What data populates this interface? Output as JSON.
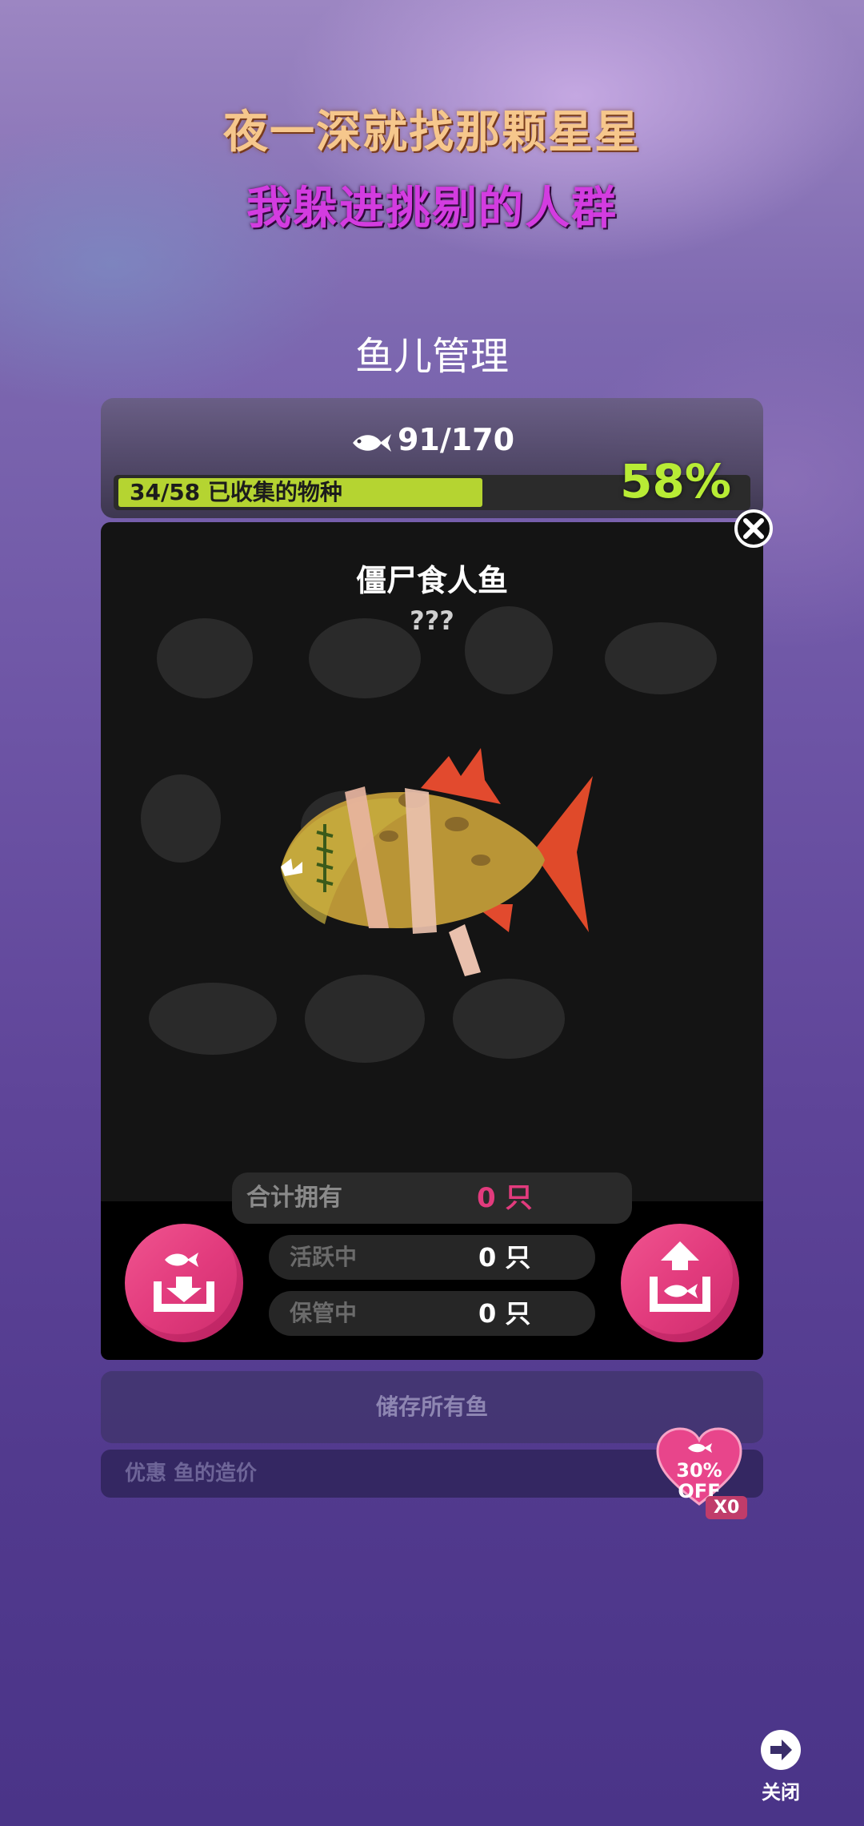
{
  "lyrics": {
    "line1": "夜一深就找那颗星星",
    "line2": "我躲进挑剔的人群"
  },
  "page": {
    "title": "鱼儿管理"
  },
  "stats": {
    "fish_count": "91/170",
    "progress_label": "34/58 已收集的物种",
    "percent": "58%",
    "progress_fraction": 0.58
  },
  "fish": {
    "name": "僵尸食人鱼",
    "info": "???"
  },
  "counts": {
    "total_label": "合计拥有",
    "total_value": "0 只",
    "active_label": "活跃中",
    "active_value": "0 只",
    "storage_label": "保管中",
    "storage_value": "0 只"
  },
  "actions": {
    "store_all": "储存所有鱼",
    "discount_text": "优惠 鱼的造价"
  },
  "discount_badge": {
    "percent": "30%",
    "off": "OFF",
    "multiplier": "X0"
  },
  "footer": {
    "close": "关闭"
  },
  "colors": {
    "accent_pink": "#e23b7d",
    "progress_green": "#b5d431",
    "percent_green": "#b8ec35"
  },
  "icons": [
    "fish-icon",
    "close-icon",
    "store-fish-icon",
    "release-fish-icon",
    "heart-badge-icon",
    "arrow-right-icon"
  ]
}
